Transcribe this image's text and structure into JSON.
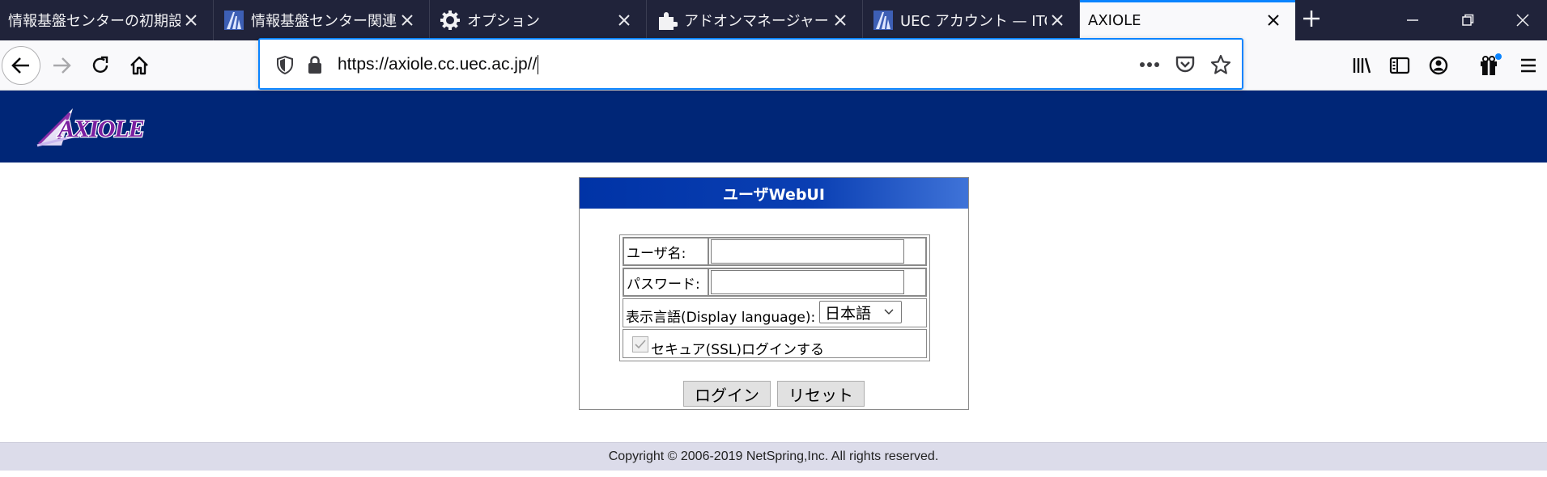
{
  "browser": {
    "tabs": [
      {
        "title": "情報基盤センターの初期設定",
        "icon": "none",
        "active": false
      },
      {
        "title": "情報基盤センター関連ウ",
        "icon": "uec-logo-icon",
        "active": false
      },
      {
        "title": "オプション",
        "icon": "gear-icon",
        "active": false
      },
      {
        "title": "アドオンマネージャー",
        "icon": "puzzle-icon",
        "active": false
      },
      {
        "title": "UEC アカウント — ITC コ",
        "icon": "uec-logo-icon",
        "active": false
      },
      {
        "title": "AXIOLE",
        "icon": "none",
        "active": true
      }
    ],
    "url": "https://axiole.cc.uec.ac.jp//"
  },
  "page": {
    "logo_text": "AXIOLE",
    "login": {
      "title": "ユーザWebUI",
      "username_label": "ユーザ名:",
      "username_value": "",
      "password_label": "パスワード:",
      "password_value": "",
      "language_label": "表示言語(Display language):",
      "language_selected": "日本語",
      "ssl_label": "セキュア(SSL)ログインする",
      "ssl_checked": true,
      "login_button": "ログイン",
      "reset_button": "リセット"
    },
    "footer": "Copyright © 2006-2019 NetSpring,Inc. All rights reserved."
  },
  "colors": {
    "tab_bar": "#20233a",
    "accent": "#0a84ff",
    "header_bg": "#002677",
    "footer_bg": "#dcdcea"
  }
}
